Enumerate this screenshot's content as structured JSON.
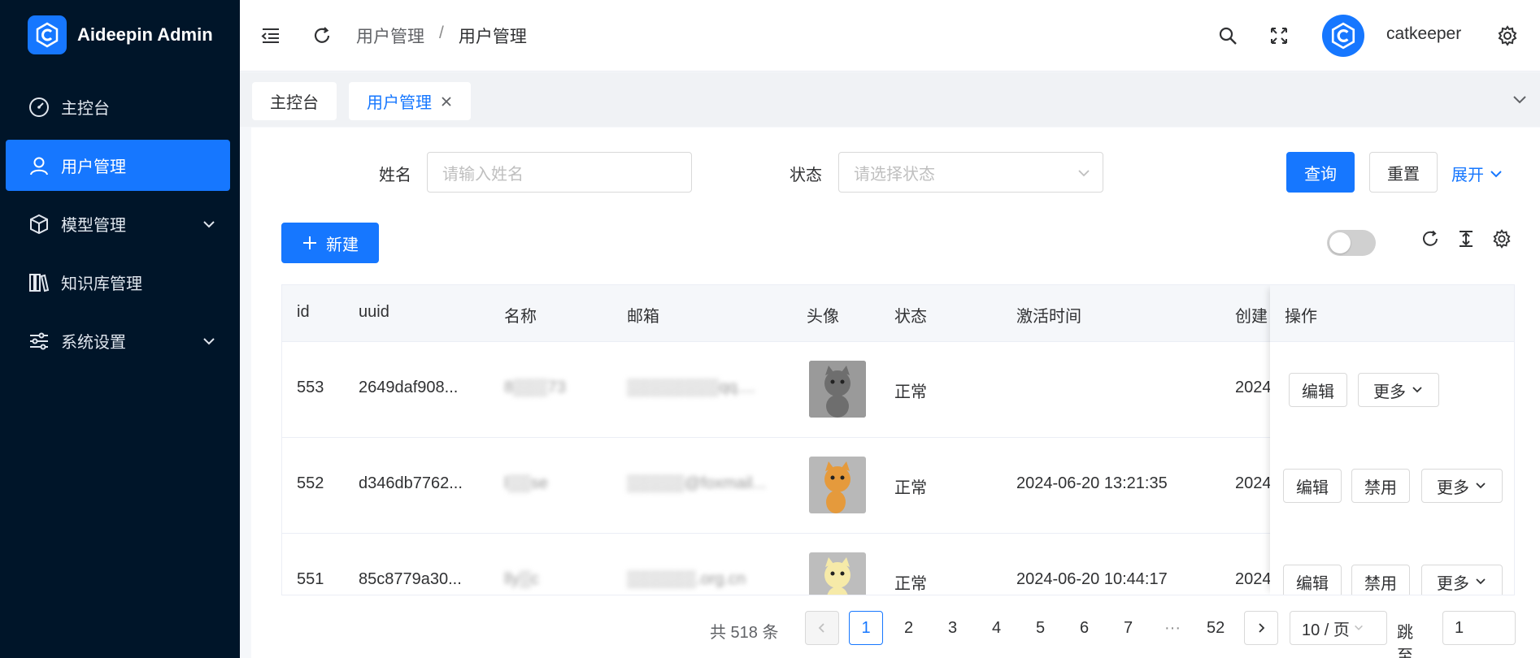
{
  "app": {
    "title": "Aideepin Admin"
  },
  "sidebar": {
    "items": [
      {
        "label": "主控台",
        "icon": "dashboard-icon",
        "active": false
      },
      {
        "label": "用户管理",
        "icon": "user-icon",
        "active": true
      },
      {
        "label": "模型管理",
        "icon": "cube-icon",
        "expandable": true
      },
      {
        "label": "知识库管理",
        "icon": "books-icon"
      },
      {
        "label": "系统设置",
        "icon": "sliders-icon",
        "expandable": true
      }
    ]
  },
  "header": {
    "breadcrumb": [
      "用户管理",
      "/",
      "用户管理"
    ],
    "username": "catkeeper",
    "icons": [
      "menu-fold-icon",
      "refresh-icon",
      "search-icon",
      "fullscreen-icon",
      "gear-icon"
    ]
  },
  "tabs": [
    {
      "label": "主控台",
      "active": false
    },
    {
      "label": "用户管理",
      "active": true,
      "closable": true
    }
  ],
  "filters": {
    "name_label": "姓名",
    "name_placeholder": "请输入姓名",
    "status_label": "状态",
    "status_placeholder": "请选择状态",
    "query_btn": "查询",
    "reset_btn": "重置",
    "expand_btn": "展开"
  },
  "toolbar": {
    "new_btn": "新建",
    "new_icon": "plus-icon"
  },
  "table": {
    "columns": [
      "id",
      "uuid",
      "名称",
      "邮箱",
      "头像",
      "状态",
      "激活时间",
      "创建",
      "操作"
    ],
    "rows": [
      {
        "id": "553",
        "uuid": "2649daf908...",
        "name": "8▒▒▒73",
        "email": "▒▒▒▒▒▒▒▒qq....",
        "status": "正常",
        "activated": "",
        "created": "2024",
        "actions": [
          "编辑",
          "更多"
        ]
      },
      {
        "id": "552",
        "uuid": "d346db7762...",
        "name": "l▒▒se",
        "email": "▒▒▒▒▒@foxmail...",
        "status": "正常",
        "activated": "2024-06-20 13:21:35",
        "created": "2024",
        "actions": [
          "编辑",
          "禁用",
          "更多"
        ]
      },
      {
        "id": "551",
        "uuid": "85c8779a30...",
        "name": "lly▒c",
        "email": "▒▒▒▒▒▒.org.cn",
        "status": "正常",
        "activated": "2024-06-20 10:44:17",
        "created": "2024",
        "actions": [
          "编辑",
          "禁用",
          "更多"
        ]
      }
    ]
  },
  "pagination": {
    "total_text": "共 518 条",
    "pages": [
      "1",
      "2",
      "3",
      "4",
      "5",
      "6",
      "7",
      "···",
      "52"
    ],
    "current": "1",
    "page_size": "10 / 页",
    "jump_label": "跳至",
    "jump_value": "1"
  },
  "colors": {
    "primary": "#1677ff",
    "sidebar_bg": "#001529",
    "active_menu": "#1677ff"
  }
}
